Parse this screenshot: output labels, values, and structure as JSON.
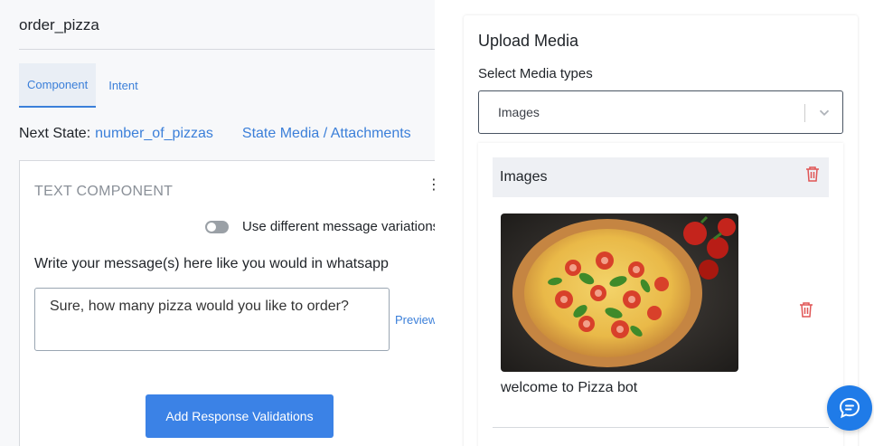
{
  "state": {
    "title": "order_pizza"
  },
  "tabs": [
    {
      "label": "Component"
    },
    {
      "label": "Intent"
    }
  ],
  "next_state": {
    "label": "Next State:",
    "value": "number_of_pizzas"
  },
  "state_media_link": "State Media / Attachments",
  "text_component": {
    "title": "TEXT COMPONENT",
    "more_label": "⋮",
    "toggle_label": "Use different message variations",
    "write_label": "Write your message(s) here like you would in whatsapp",
    "message": "Sure, how many pizza would you like to order?",
    "preview_label": "Preview",
    "validate_button": "Add Response Validations"
  },
  "upload_media": {
    "title": "Upload Media",
    "select_label": "Select Media types",
    "select_value": "Images",
    "section_title": "Images",
    "caption": "welcome to Pizza bot"
  },
  "colors": {
    "accent": "#3b82e6",
    "link": "#3b7fd9",
    "danger": "#e05555"
  },
  "icons": {
    "section_delete": "trash-icon",
    "image_delete": "trash-icon",
    "chat": "chat-bubble-icon",
    "dropdown": "chevron-down-icon"
  }
}
